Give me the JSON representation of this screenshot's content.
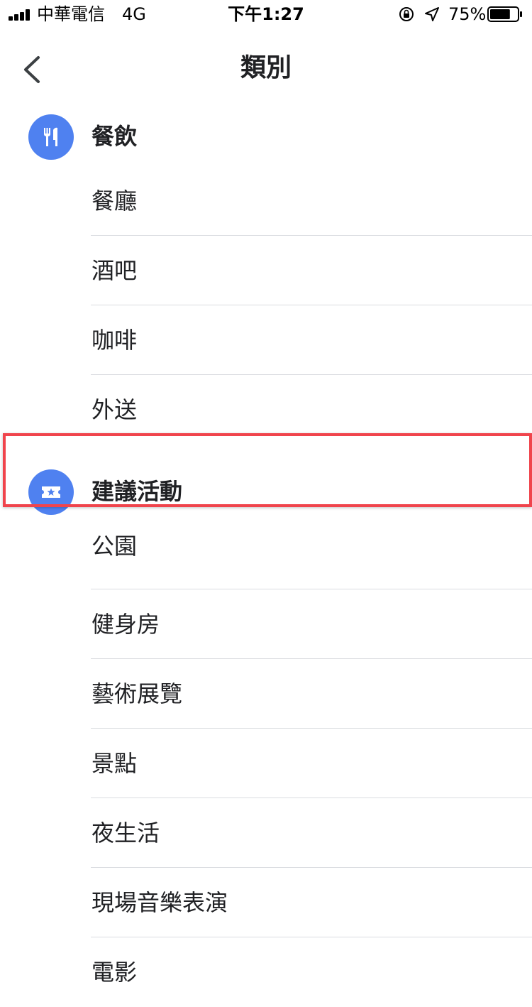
{
  "status_bar": {
    "carrier": "中華電信",
    "network": "4G",
    "time": "下午1:27",
    "battery_percent": "75%",
    "battery_level": 0.75
  },
  "header": {
    "title": "類別"
  },
  "groups": [
    {
      "label": "餐飲",
      "icon": "fork-knife-icon",
      "items": [
        "餐廳",
        "酒吧",
        "咖啡",
        "外送"
      ]
    },
    {
      "label": "建議活動",
      "icon": "ticket-star-icon",
      "items": [
        "公園",
        "健身房",
        "藝術展覽",
        "景點",
        "夜生活",
        "現場音樂表演",
        "電影"
      ]
    }
  ],
  "colors": {
    "icon_circle": "#4f81f0",
    "highlight": "#f0444c",
    "divider": "#dadce0"
  }
}
